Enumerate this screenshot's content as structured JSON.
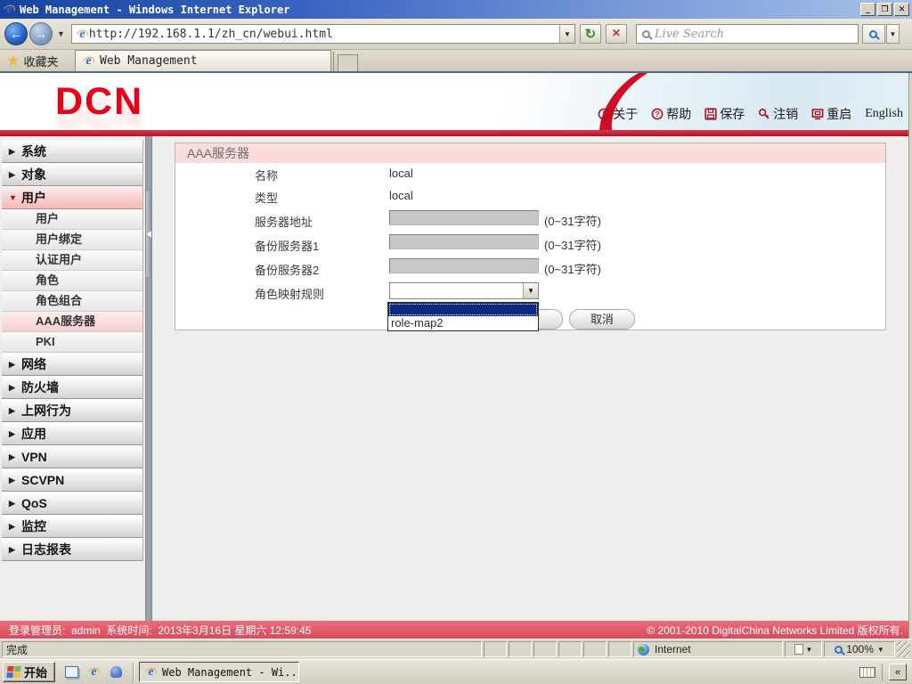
{
  "window": {
    "title": "Web Management - Windows Internet Explorer"
  },
  "browser": {
    "url": "http://192.168.1.1/zh_cn/webui.html",
    "search_placeholder": "Live Search",
    "favorites_label": "收藏夹",
    "tab_title": "Web Management"
  },
  "header": {
    "logo": "DCN",
    "links": {
      "about": "关于",
      "help": "帮助",
      "save": "保存",
      "logout": "注销",
      "restart": "重启",
      "english": "English"
    }
  },
  "sidebar": {
    "items": [
      "系统",
      "对象",
      "用户",
      "用户",
      "用户绑定",
      "认证用户",
      "角色",
      "角色组合",
      "AAA服务器",
      "PKI",
      "网络",
      "防火墙",
      "上网行为",
      "应用",
      "VPN",
      "SCVPN",
      "QoS",
      "监控",
      "日志报表"
    ]
  },
  "content": {
    "title": "AAA服务器",
    "rows": [
      {
        "label": "名称",
        "value": "local"
      },
      {
        "label": "类型",
        "value": "local"
      },
      {
        "label": "服务器地址",
        "hint": "(0~31字符)"
      },
      {
        "label": "备份服务器1",
        "hint": "(0~31字符)"
      },
      {
        "label": "备份服务器2",
        "hint": "(0~31字符)"
      },
      {
        "label": "角色映射规则"
      }
    ],
    "dropdown_options": [
      "",
      "role-map2"
    ],
    "buttons": {
      "cancel": "取消"
    }
  },
  "footer": {
    "login_info": "登录管理员:  admin  系统时间:  2013年3月16日 星期六 12:59:45",
    "copyright": "© 2001-2010 DigitalChina Networks Limited 版权所有."
  },
  "statusbar": {
    "status": "完成",
    "zone": "Internet",
    "zoom": "100%"
  },
  "taskbar": {
    "start_label": "开始",
    "task_label": "Web Management - Wi..."
  }
}
